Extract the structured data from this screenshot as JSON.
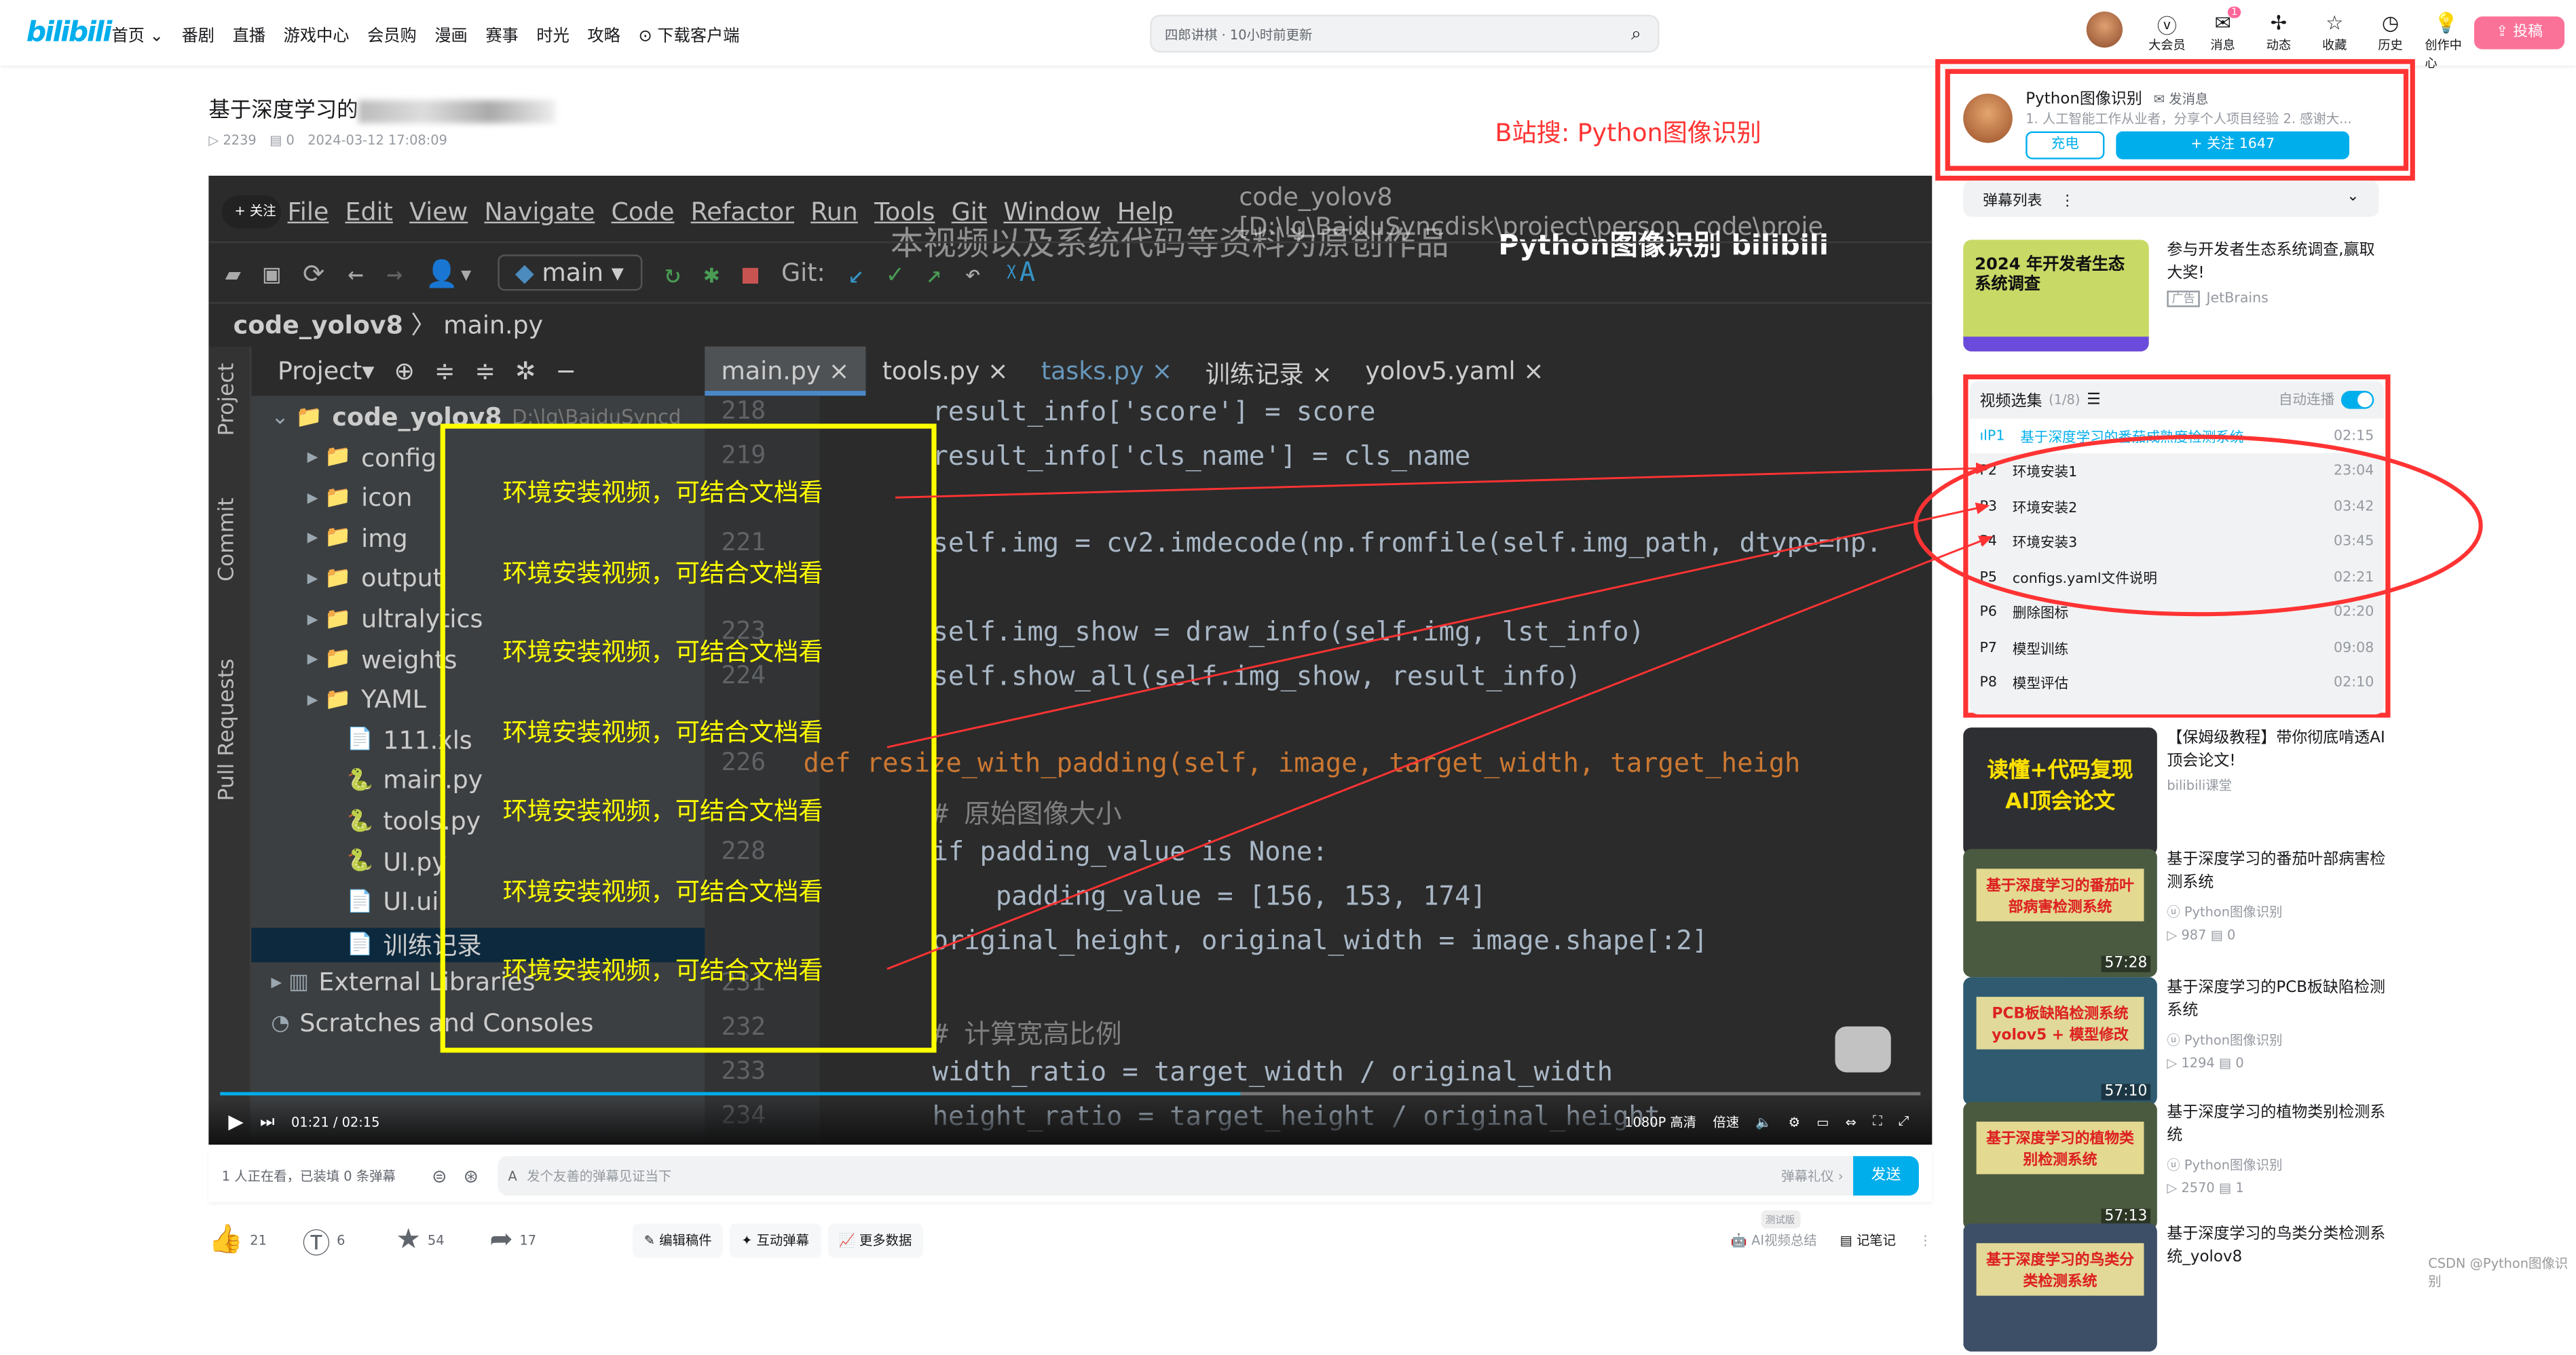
{
  "nav": {
    "logo": "bilibili",
    "items": [
      "首页 ⌄",
      "番剧",
      "直播",
      "游戏中心",
      "会员购",
      "漫画",
      "赛事",
      "时光",
      "攻略",
      "⊙ 下载客户端"
    ],
    "search_placeholder": "四郎讲棋 · 10小时前更新",
    "right": [
      {
        "icon": "vip-icon",
        "label": "大会员"
      },
      {
        "icon": "message-icon",
        "label": "消息",
        "badge": "1"
      },
      {
        "icon": "dynamic-icon",
        "label": "动态"
      },
      {
        "icon": "star-icon",
        "label": "收藏"
      },
      {
        "icon": "history-icon",
        "label": "历史"
      },
      {
        "icon": "bulb-icon",
        "label": "创作中心"
      }
    ],
    "upload": "投稿"
  },
  "video": {
    "title": "基于深度学习的",
    "views": "2239",
    "danmaku": "0",
    "date": "2024-03-12 17:08:09"
  },
  "player": {
    "menu": [
      "File",
      "Edit",
      "View",
      "Navigate",
      "Code",
      "Refactor",
      "Run",
      "Tools",
      "Git",
      "Window",
      "Help"
    ],
    "project_title": "code_yolov8 [D:\\lg\\BaiduSyncdisk\\project\\person_code\\proje",
    "follow_label": "+ 关注",
    "watermark": "本视频以及系统代码等资料为原创作品",
    "watermark_brand": "Python图像识别 bilibili",
    "branch": "main",
    "git_label": "Git:",
    "breadcrumb": [
      "code_yolov8",
      "main.py"
    ],
    "side_labels": [
      "Project",
      "Commit",
      "Pull Requests"
    ],
    "project_label": "Project▾",
    "tabs": [
      "main.py",
      "tools.py",
      "tasks.py",
      "训练记录",
      "yolov5.yaml"
    ],
    "tree": [
      {
        "label": "code_yolov8",
        "suffix": "D:\\lg\\BaiduSyncd",
        "depth": 0,
        "icon": "folder"
      },
      {
        "label": "config",
        "depth": 1,
        "icon": "folder"
      },
      {
        "label": "icon",
        "depth": 1,
        "icon": "folder"
      },
      {
        "label": "img",
        "depth": 1,
        "icon": "folder"
      },
      {
        "label": "output",
        "depth": 1,
        "icon": "folder"
      },
      {
        "label": "ultralytics",
        "depth": 1,
        "icon": "folder"
      },
      {
        "label": "weights",
        "depth": 1,
        "icon": "folder"
      },
      {
        "label": "YAML",
        "depth": 1,
        "icon": "folder"
      },
      {
        "label": "111.xls",
        "depth": 2,
        "icon": "file"
      },
      {
        "label": "main.py",
        "depth": 2,
        "icon": "py"
      },
      {
        "label": "tools.py",
        "depth": 2,
        "icon": "py"
      },
      {
        "label": "UI.py",
        "depth": 2,
        "icon": "py"
      },
      {
        "label": "UI.ui",
        "depth": 2,
        "icon": "file"
      },
      {
        "label": "训练记录",
        "depth": 2,
        "icon": "file",
        "selected": true
      },
      {
        "label": "External Libraries",
        "depth": 0,
        "icon": "lib"
      },
      {
        "label": "Scratches and Consoles",
        "depth": 0,
        "icon": "scratch"
      }
    ],
    "line_numbers": [
      "218",
      "219",
      "",
      "221",
      "",
      "223",
      "224",
      "",
      "226",
      "",
      "228",
      "",
      "",
      "231",
      "232",
      "233",
      "234"
    ],
    "code": [
      {
        "t": "    result_info['score'] = score"
      },
      {
        "t": "    result_info['cls_name'] = cls_name"
      },
      {
        "t": ""
      },
      {
        "t": "    self.img = cv2.imdecode(np.fromfile(self.img_path, dtype=np."
      },
      {
        "t": ""
      },
      {
        "t": "    self.img_show = draw_info(self.img, lst_info)"
      },
      {
        "t": "    self.show_all(self.img_show, result_info)"
      },
      {
        "t": ""
      },
      {
        "t": "def resize_with_padding(self, image, target_width, target_heigh",
        "k": "kw"
      },
      {
        "t": "    # 原始图像大小",
        "k": "cm"
      },
      {
        "t": "    if padding_value is None:"
      },
      {
        "t": "        padding_value = [156, 153, 174]"
      },
      {
        "t": "    original_height, original_width = image.shape[:2]"
      },
      {
        "t": ""
      },
      {
        "t": "    # 计算宽高比例",
        "k": "cm"
      },
      {
        "t": "    width_ratio = target_width / original_width"
      },
      {
        "t": "    height_ratio = target_height / original_height"
      }
    ],
    "overlay_text": [
      "环境安装视频，可结合文档看",
      "环境安装视频，可结合文档看",
      "环境安装视频，可结合文档看",
      "环境安装视频，可结合文档看",
      "环境安装视频，可结合文档看",
      "环境安装视频，可结合文档看",
      "环境安装视频，可结合文档看"
    ],
    "time": "01:21 / 02:15",
    "progress": 0.6,
    "quality": "1080P 高清",
    "speed": "倍速"
  },
  "danmaku_bar": {
    "watching": "1 人正在看，已装填 0 条弹幕",
    "placeholder": "发个友善的弹幕见证当下",
    "etiquette": "弹幕礼仪 ›",
    "send": "发送"
  },
  "actions": {
    "like": "21",
    "coin": "6",
    "fav": "54",
    "share": "17",
    "buttons": [
      "编辑稿件",
      "互动弹幕",
      "更多数据"
    ],
    "beta": "测试版",
    "ai": "AI视频总结",
    "note": "记笔记"
  },
  "annotation": "B站搜: Python图像识别",
  "uploader": {
    "name": "Python图像识别",
    "msg": "发消息",
    "desc": "1. 人工智能工作从业者，分享个人项目经验 2. 感谢大...",
    "charge": "充电",
    "follow": "+ 关注 1647"
  },
  "danmaku_list": "弹幕列表",
  "ad": {
    "img_text": "2024 年开发者生态系统调查",
    "title": "参与开发者生态系统调查,赢取大奖!",
    "tag": "广告",
    "source": "JetBrains"
  },
  "playlist": {
    "title": "视频选集",
    "count": "(1/8)",
    "autoplay": "自动连播",
    "autoplay_on": true,
    "items": [
      {
        "p": "P1",
        "t": "基于深度学习的番茄成熟度检测系统",
        "d": "02:15"
      },
      {
        "p": "P2",
        "t": "环境安装1",
        "d": "23:04"
      },
      {
        "p": "P3",
        "t": "环境安装2",
        "d": "03:42"
      },
      {
        "p": "P4",
        "t": "环境安装3",
        "d": "03:45"
      },
      {
        "p": "P5",
        "t": "configs.yaml文件说明",
        "d": "02:21"
      },
      {
        "p": "P6",
        "t": "删除图标",
        "d": "02:20"
      },
      {
        "p": "P7",
        "t": "模型训练",
        "d": "09:08"
      },
      {
        "p": "P8",
        "t": "模型评估",
        "d": "02:10"
      }
    ]
  },
  "recs": [
    {
      "thumb": "读懂+代码复现 AI顶会论文",
      "title": "【保姆级教程】带你彻底啃透AI顶会论文!",
      "up": "bilibili课堂",
      "views": "",
      "dm": "",
      "dur": ""
    },
    {
      "thumb": "基于深度学习的番茄叶部病害检测系统",
      "title": "基于深度学习的番茄叶部病害检测系统",
      "up": "Python图像识别",
      "views": "987",
      "dm": "0",
      "dur": "57:28"
    },
    {
      "thumb": "PCB板缺陷检测系统 yolov5 + 模型修改",
      "title": "基于深度学习的PCB板缺陷检测系统",
      "up": "Python图像识别",
      "views": "1294",
      "dm": "0",
      "dur": "57:10"
    },
    {
      "thumb": "基于深度学习的植物类别检测系统",
      "title": "基于深度学习的植物类别检测系统",
      "up": "Python图像识别",
      "views": "2570",
      "dm": "1",
      "dur": "57:13"
    },
    {
      "thumb": "基于深度学习的鸟类分类检测系统",
      "title": "基于深度学习的鸟类分类检测系统_yolov8",
      "up": "",
      "views": "",
      "dm": "",
      "dur": ""
    }
  ],
  "csdn": "CSDN @Python图像识别",
  "colors": {
    "accent": "#00aeec",
    "pink": "#fb7299",
    "annotation_red": "#ff3333",
    "overlay_yellow": "#ffff00"
  }
}
